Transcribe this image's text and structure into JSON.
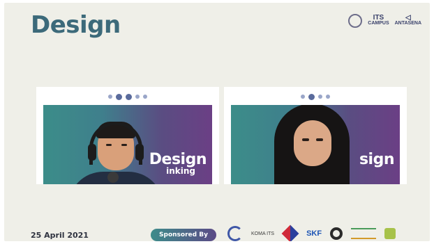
{
  "header": {
    "title": "Design",
    "logo_1": "ITS",
    "logo_1_sub": "CAMPUS",
    "logo_2": "ANTASENA"
  },
  "video": {
    "left_poster_text": "Design",
    "left_poster_sub": "inking",
    "right_poster_text": "sign"
  },
  "footer": {
    "date": "25 April 2021",
    "sponsored_label": "Sponsored By",
    "sponsor_koma": "KOMA ITS",
    "sponsor_skf": "SKF"
  },
  "colors": {
    "title": "#3c6a7a",
    "poster_start": "#3c8d89",
    "poster_end": "#6b3f85"
  }
}
